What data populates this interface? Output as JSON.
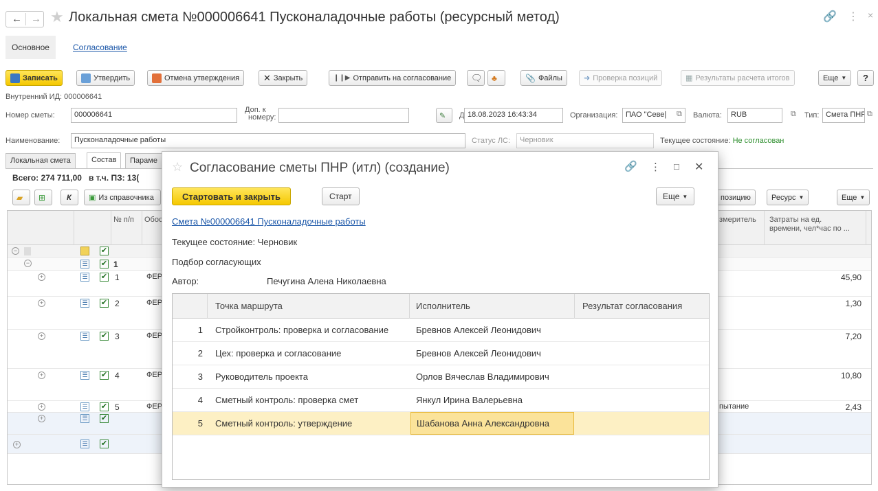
{
  "window": {
    "title": "Локальная смета №000006641 Пусконаладочные работы (ресурсный метод)",
    "nav_tabs": [
      "Основное",
      "Согласование"
    ]
  },
  "toolbar": {
    "save": "Записать",
    "approve": "Утвердить",
    "cancel_approve": "Отмена утверждения",
    "close": "Закрыть",
    "send_approval": "Отправить на согласование",
    "files": "Файлы",
    "check_positions": "Проверка позиций",
    "results": "Результаты расчета итогов",
    "more": "Еще",
    "help": "?"
  },
  "form": {
    "internal_id_label": "Внутренний ИД:",
    "internal_id": "000006641",
    "number_label": "Номер сметы:",
    "number": "000006641",
    "extra_label_1": "Доп. к",
    "extra_label_2": "номеру:",
    "extra_value": "",
    "date_label": "Дата:",
    "date": "18.08.2023 16:43:34",
    "org_label": "Организация:",
    "org": "ПАО \"Севе|",
    "currency_label": "Валюта:",
    "currency": "RUB",
    "type_label": "Тип:",
    "type": "Смета ПНР",
    "name_label": "Наименование:",
    "name": "Пусконаладочные работы",
    "status_ls_label": "Статус ЛС:",
    "status_ls": "Черновик",
    "state_label": "Текущее состояние:",
    "state": "Не согласован"
  },
  "tabs": [
    "Локальная смета",
    "Состав",
    "Параме"
  ],
  "composition": {
    "total_label": "Всего: 274 711,00",
    "incl_label": "в т.ч. ПЗ: 13(",
    "k_label": "К",
    "from_ref": "Из справочника",
    "position_btn": "позицию",
    "resource_btn": "Ресурс",
    "more": "Еще",
    "col_num": "№ п/п",
    "col_basis": "Обос",
    "col_meter": "змеритель",
    "col_cost_1": "Затраты на ед.",
    "col_cost_2": "времени, чел*час по ...",
    "rows": [
      {
        "num": "1",
        "basis": "",
        "meter": "",
        "cost": ""
      },
      {
        "num": "1",
        "basis": "ФЕР",
        "meter": "",
        "cost": "45,90"
      },
      {
        "num": "2",
        "basis": "ФЕР",
        "meter": "",
        "cost": "1,30"
      },
      {
        "num": "3",
        "basis": "ФЕР",
        "meter": "",
        "cost": "7,20"
      },
      {
        "num": "4",
        "basis": "ФЕР",
        "meter": "",
        "cost": "10,80"
      },
      {
        "num": "5",
        "basis": "ФЕР",
        "meter": "пытание",
        "cost": "2,43"
      }
    ]
  },
  "modal": {
    "title": "Согласование сметы ПНР (итл) (создание)",
    "start_close": "Стартовать и закрыть",
    "start": "Старт",
    "more": "Еще",
    "link": "Смета №000006641 Пусконаладочные работы",
    "state_label": "Текущее состояние:",
    "state": "Черновик",
    "picking": "Подбор согласующих",
    "author_label": "Автор:",
    "author": "Печугина Алена Николаевна",
    "col_point": "Точка маршрута",
    "col_executor": "Исполнитель",
    "col_result": "Результат согласования",
    "route": [
      {
        "n": "1",
        "point": "Стройконтроль: проверка и согласование",
        "executor": "Бревнов Алексей Леонидович",
        "result": ""
      },
      {
        "n": "2",
        "point": "Цех: проверка и согласование",
        "executor": "Бревнов Алексей Леонидович",
        "result": ""
      },
      {
        "n": "3",
        "point": "Руководитель проекта",
        "executor": "Орлов Вячеслав Владимирович",
        "result": ""
      },
      {
        "n": "4",
        "point": "Сметный контроль: проверка смет",
        "executor": "Янкул Ирина Валерьевна",
        "result": ""
      },
      {
        "n": "5",
        "point": "Сметный контроль: утверждение",
        "executor": "Шабанова Анна Александровна",
        "result": ""
      }
    ]
  },
  "colors": {
    "accent_yellow": "#f5c800",
    "link": "#1a56a8",
    "status_green": "#2f8f2f",
    "selection": "#fdf0c4"
  }
}
